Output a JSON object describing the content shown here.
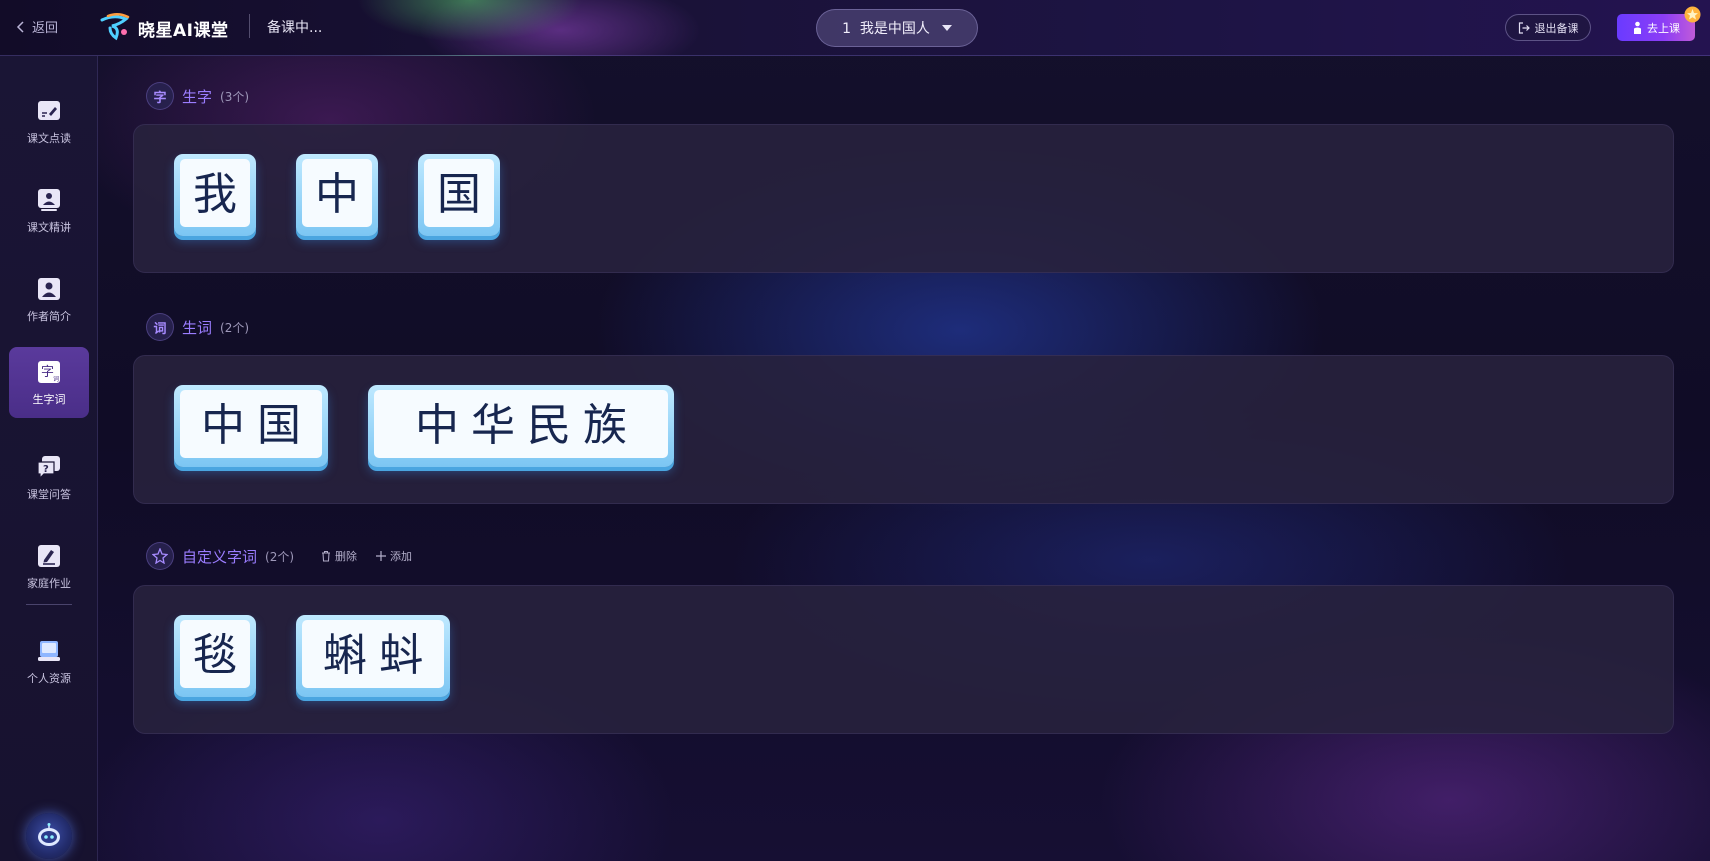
{
  "topbar": {
    "back_label": "返回",
    "logo_text": "晓星AI课堂",
    "status": "备课中...",
    "lesson_select": "1  我是中国人",
    "exit_label": "退出备课",
    "class_label": "去上课"
  },
  "sidebar": {
    "items": [
      {
        "label": "课文点读",
        "icon": "reading-icon",
        "active": false
      },
      {
        "label": "课文精讲",
        "icon": "lecture-icon",
        "active": false
      },
      {
        "label": "作者简介",
        "icon": "author-icon",
        "active": false
      },
      {
        "label": "生字词",
        "icon": "character-icon",
        "active": true
      },
      {
        "label": "课堂问答",
        "icon": "qa-icon",
        "active": false
      },
      {
        "label": "家庭作业",
        "icon": "homework-icon",
        "active": false
      },
      {
        "label": "个人资源",
        "icon": "resource-icon",
        "active": false
      }
    ]
  },
  "sections": {
    "characters": {
      "icon_char": "字",
      "title": "生字",
      "count": "(3个)",
      "items": [
        "我",
        "中",
        "国"
      ]
    },
    "words": {
      "icon_char": "词",
      "title": "生词",
      "count": "(2个)",
      "items": [
        "中国",
        "中华民族"
      ]
    },
    "custom": {
      "title": "自定义字词",
      "count": "(2个)",
      "delete_label": "删除",
      "add_label": "添加",
      "items": [
        "毯",
        "蝌蚪"
      ]
    }
  },
  "colors": {
    "accent": "#9b7dff",
    "active_sidebar": "#5a3a9c",
    "card_border": "#7cc6f3",
    "primary_button": "#7a3cfb"
  }
}
